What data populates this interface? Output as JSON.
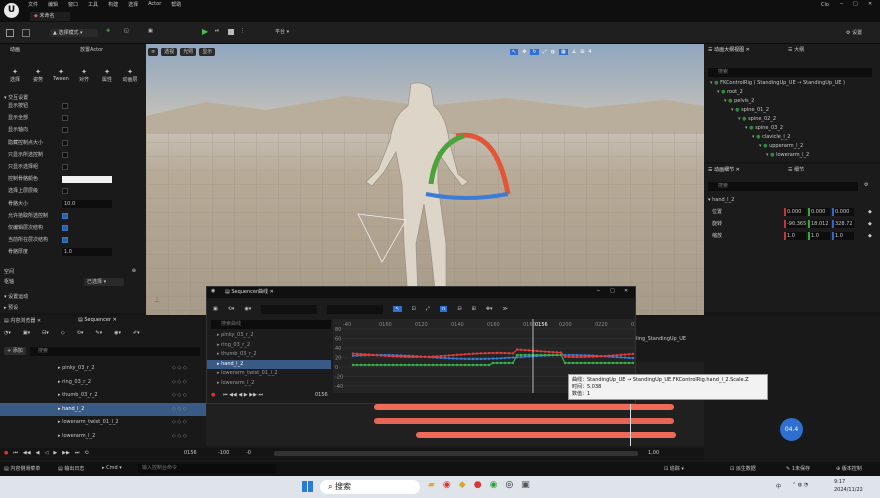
{
  "menu": [
    "文件",
    "编辑",
    "窗口",
    "工具",
    "构建",
    "选择",
    "Actor",
    "帮助"
  ],
  "window": {
    "tab_title": "未命名",
    "user": "Clo"
  },
  "toolbar": {
    "mode_label": "选择模式",
    "platform_label": "平台",
    "settings_label": "设置"
  },
  "left_panel": {
    "tabs": [
      "动画",
      "放置Actor"
    ],
    "tools": [
      "选择",
      "姿势",
      "Tween",
      "对齐",
      "属性",
      "动画层"
    ],
    "section_settings": "交互设置",
    "settings": [
      {
        "label": "显示按钮",
        "type": "check",
        "on": false
      },
      {
        "label": "显示全部",
        "type": "check",
        "on": false
      },
      {
        "label": "显示轴向",
        "type": "check",
        "on": false
      },
      {
        "label": "隐藏控制点大小",
        "type": "check",
        "on": false
      },
      {
        "label": "只显示所选控制",
        "type": "check",
        "on": false
      },
      {
        "label": "只显示选择组",
        "type": "check",
        "on": false
      },
      {
        "label": "控制骨骼颜色",
        "type": "color"
      },
      {
        "label": "选择上层层级",
        "type": "check",
        "on": false
      },
      {
        "label": "骨骼大小",
        "type": "value",
        "value": "10.0"
      },
      {
        "label": "允许拾取所选控制",
        "type": "check",
        "on": true
      },
      {
        "label": "仅编辑层次结构",
        "type": "check",
        "on": true
      },
      {
        "label": "当前所在层次结构",
        "type": "check",
        "on": true
      },
      {
        "label": "骨骼厚度",
        "type": "value",
        "value": "1.0"
      }
    ],
    "space_label": "空间",
    "pivot_label": "枢轴",
    "pivot_value": "已选择",
    "section_more": "设置运动",
    "section_misc": "预设"
  },
  "viewport": {
    "buttons": [
      "透视",
      "光照",
      "显示"
    ],
    "camera_speed": "4"
  },
  "outliner": {
    "tabs": [
      "动画大纲视图",
      "大纲"
    ],
    "search_placeholder": "搜索",
    "items": [
      {
        "label": "FKControlRig ( StandingUp_UE → StandingUp_UE )",
        "indent": 0
      },
      {
        "label": "root_2",
        "indent": 1
      },
      {
        "label": "pelvis_2",
        "indent": 2
      },
      {
        "label": "spine_01_2",
        "indent": 3
      },
      {
        "label": "spine_02_2",
        "indent": 4
      },
      {
        "label": "spine_03_2",
        "indent": 5
      },
      {
        "label": "clavicle_l_2",
        "indent": 6
      },
      {
        "label": "upperarm_l_2",
        "indent": 7
      },
      {
        "label": "lowerarm_l_2",
        "indent": 8
      }
    ]
  },
  "details": {
    "tabs": [
      "动画细节",
      "细节"
    ],
    "search_placeholder": "搜索",
    "section": "hand_l_2",
    "rows": [
      {
        "label": "位置",
        "values": [
          "0.000",
          "0.000",
          "0.000"
        ]
      },
      {
        "label": "旋转",
        "values": [
          "-90.365",
          "18.012",
          "328.72"
        ]
      },
      {
        "label": "缩放",
        "values": [
          "1.0",
          "1.0",
          "1.0"
        ]
      }
    ]
  },
  "content": {
    "tabs": [
      "内容浏览器",
      "Sequencer"
    ],
    "add_label": "+ 添加",
    "search_placeholder": "搜索",
    "tracks": [
      "pinky_03_r_2",
      "ring_03_r_2",
      "thumb_03_r_2",
      "hand_l_2",
      "lowerarm_twist_01_l_2",
      "lowerarm_l_2"
    ],
    "selected": 3,
    "frame": "0156",
    "range_start": "-100",
    "range_end": "1,00",
    "range_mid": "-0"
  },
  "sequencer": {
    "title": "Sequencer曲线",
    "search_placeholder": "搜索曲线",
    "tracks": [
      "pinky_03_r_2",
      "ring_03_r_2",
      "thumb_03_r_2",
      "hand_l_2",
      "lowerarm_twist_01_l_2",
      "lowerarm_l_2"
    ],
    "selected": 3,
    "frame": "0156",
    "y_ticks": [
      "80",
      "60",
      "40",
      "20",
      "0",
      "-20",
      "-40"
    ],
    "x_ticks": [
      "-40",
      "0160",
      "0120",
      "0140",
      "0160",
      "0160",
      "0200",
      "0220",
      "0240"
    ],
    "object_label": "ling_StandingUp_UE",
    "tooltip": [
      "曲线：StandingUp_UE → StandingUp_UE.FKControlRig.hand_l_2.Scale.Z",
      "时间：5.038",
      "数值：1"
    ],
    "playhead_frame": "0156"
  },
  "badge": "04.4",
  "status": {
    "items": [
      "内容侧滑菜单",
      "输出日志",
      "Cmd"
    ],
    "cmd_placeholder": "输入控制台命令",
    "right": [
      "追踪",
      "派生数据",
      "1未保存",
      "版本控制"
    ]
  },
  "taskbar": {
    "search": "搜索",
    "time": "9:17",
    "date": "2024/11/22",
    "lang": "中"
  },
  "colors": {
    "accent": "#2f6fd1",
    "curve_red": "#e23b3b",
    "curve_green": "#34b34a",
    "curve_blue": "#3a7cd8",
    "key_red": "#f06a5a"
  }
}
